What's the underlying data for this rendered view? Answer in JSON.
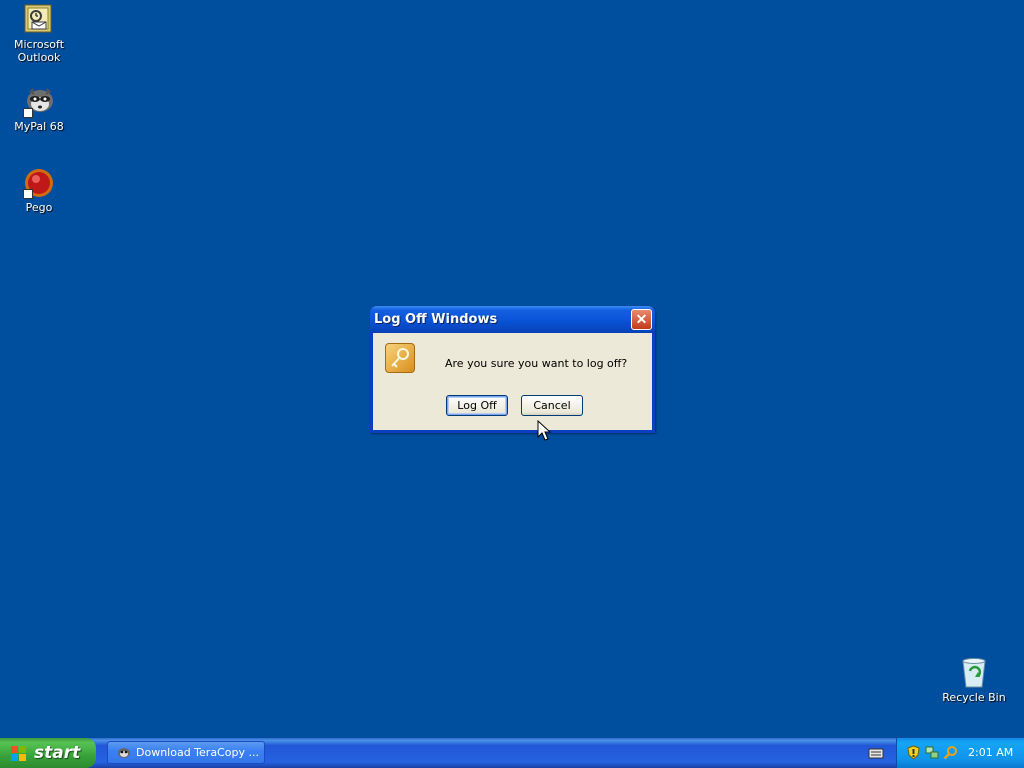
{
  "desktop": {
    "background_color": "#004f9f",
    "icons": [
      {
        "label_line1": "Microsoft",
        "label_line2": "Outlook",
        "icon": "outlook-icon"
      },
      {
        "label_line1": "MyPal 68",
        "icon": "mypal-icon"
      },
      {
        "label_line1": "Pego",
        "icon": "pego-icon"
      },
      {
        "label_line1": "Recycle Bin",
        "icon": "recycle-bin-icon"
      }
    ]
  },
  "dialog": {
    "title": "Log Off Windows",
    "close_icon": "close-icon",
    "icon": "key-icon",
    "message": "Are you sure you want to log off?",
    "log_off_label": "Log Off",
    "cancel_label": "Cancel"
  },
  "taskbar": {
    "start_label": "start",
    "task_button_label": "Download TeraCopy ...",
    "clock": "2:01 AM",
    "tray_icons": [
      "keyboard-icon",
      "security-shield-icon",
      "network-icon",
      "search-icon"
    ]
  },
  "colors": {
    "titlebar_blue": "#0a55d8",
    "start_green": "#38a23a",
    "taskbar_blue": "#2663e0",
    "dialog_face": "#ece9d8"
  }
}
